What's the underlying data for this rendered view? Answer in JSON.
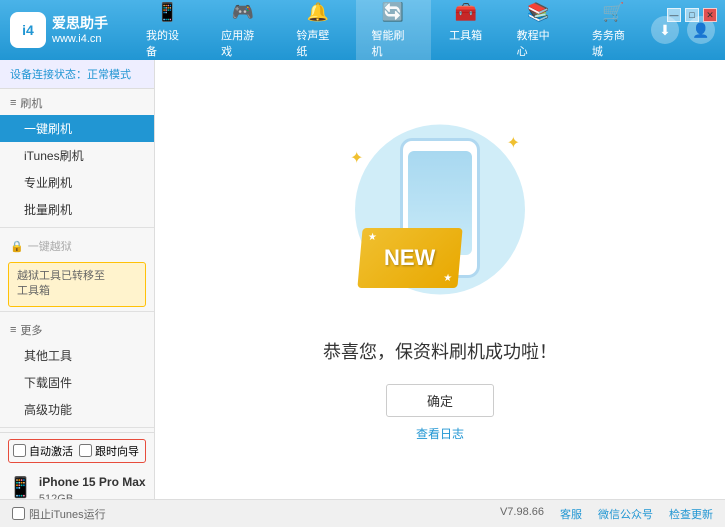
{
  "app": {
    "logo_text": "爱思助手",
    "logo_subtext": "www.i4.cn"
  },
  "header": {
    "tabs": [
      {
        "id": "my-device",
        "label": "我的设备",
        "icon": "📱"
      },
      {
        "id": "app-games",
        "label": "应用游戏",
        "icon": "🎮"
      },
      {
        "id": "ringtone",
        "label": "铃声壁纸",
        "icon": "🔔"
      },
      {
        "id": "smart-flash",
        "label": "智能刷机",
        "icon": "🔄"
      },
      {
        "id": "toolbox",
        "label": "工具箱",
        "icon": "🧰"
      },
      {
        "id": "tutorial",
        "label": "教程中心",
        "icon": "📚"
      },
      {
        "id": "service",
        "label": "务务商城",
        "icon": "🛒"
      }
    ],
    "download_icon": "⬇",
    "user_icon": "👤"
  },
  "window_controls": {
    "minimize": "—",
    "maximize": "□",
    "close": "✕"
  },
  "sidebar": {
    "status_label": "设备连接状态：",
    "status_value": "正常模式",
    "sections": [
      {
        "label": "刷机",
        "icon": "≡",
        "items": [
          {
            "id": "one-key-flash",
            "label": "一键刷机",
            "active": true
          },
          {
            "id": "itunes-flash",
            "label": "iTunes刷机",
            "active": false
          },
          {
            "id": "pro-flash",
            "label": "专业刷机",
            "active": false
          },
          {
            "id": "batch-flash",
            "label": "批量刷机",
            "active": false
          }
        ]
      },
      {
        "label": "一键越狱",
        "icon": "🔒",
        "disabled": true,
        "notice": "越狱工具已转移至\n工具箱"
      },
      {
        "label": "更多",
        "icon": "≡",
        "items": [
          {
            "id": "other-tools",
            "label": "其他工具",
            "active": false
          },
          {
            "id": "download-firmware",
            "label": "下载固件",
            "active": false
          },
          {
            "id": "advanced",
            "label": "高级功能",
            "active": false
          }
        ]
      }
    ],
    "device_checkboxes": [
      {
        "id": "auto-activate",
        "label": "自动激活",
        "checked": false
      },
      {
        "id": "time-guide",
        "label": "跟时向导",
        "checked": false
      }
    ],
    "device": {
      "name": "iPhone 15 Pro Max",
      "storage": "512GB",
      "type": "iPhone"
    }
  },
  "content": {
    "success_message": "恭喜您，保资料刷机成功啦！",
    "confirm_button": "确定",
    "log_link": "查看日志"
  },
  "bottom_bar": {
    "itunes_checkbox": "阻止iTunes运行",
    "version": "V7.98.66",
    "items": [
      "客服",
      "微信公众号",
      "检查更新"
    ]
  }
}
